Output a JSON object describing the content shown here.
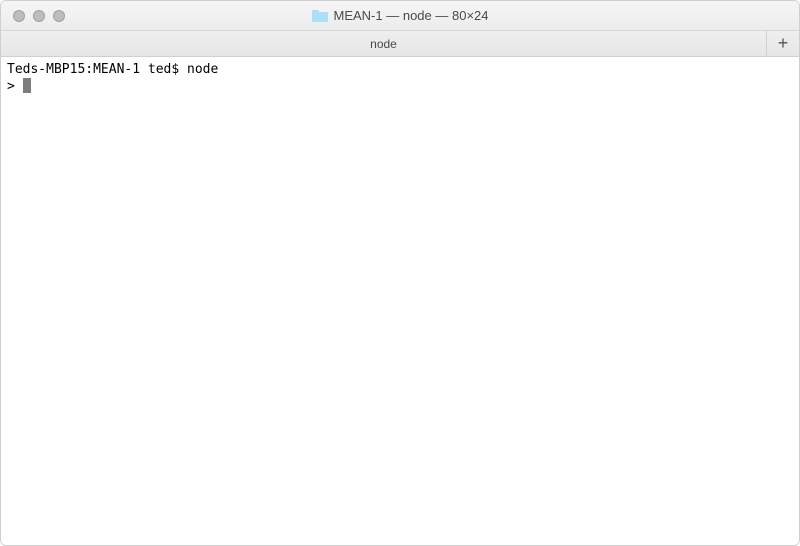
{
  "window": {
    "title": "MEAN-1 — node — 80×24"
  },
  "tabs": [
    {
      "label": "node"
    }
  ],
  "new_tab_label": "+",
  "terminal": {
    "line1_prompt": "Teds-MBP15:MEAN-1 ted$ ",
    "line1_command": "node",
    "line2_prompt": "> "
  }
}
